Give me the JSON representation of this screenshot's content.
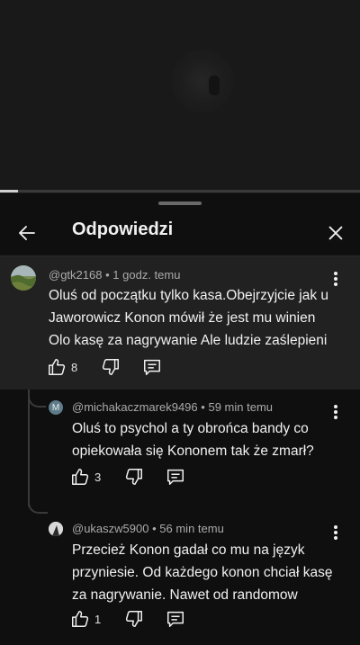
{
  "video": {
    "progress_fraction": 0.05
  },
  "header": {
    "title": "Odpowiedzi"
  },
  "comments": [
    {
      "author": "@gtk2168",
      "separator": "•",
      "time": "1 godz. temu",
      "lines": [
        "Oluś od początku tylko kasa.Obejrzyjcie jak u",
        "Jaworowicz Konon mówił że jest mu winien",
        "Olo kasę za nagrywanie Ale ludzie zaślepieni"
      ],
      "likes": "8"
    },
    {
      "author": "@michakaczmarek9496",
      "avatar_letter": "M",
      "separator": "•",
      "time": "59 min temu",
      "lines": [
        "Oluś to psychol a ty obrońca bandy co",
        "opiekowała się Kononem tak że zmarł?"
      ],
      "likes": "3"
    },
    {
      "author": "@ukaszw5900",
      "separator": "•",
      "time": "56 min temu",
      "lines": [
        "Przecież Konon gadał co mu na język",
        "przyniesie. Od każdego konon chciał kasę",
        "za nagrywanie. Nawet od randomow"
      ],
      "likes": "1"
    }
  ],
  "colors": {
    "background": "#0f0f0f",
    "highlight": "#212121",
    "text": "#f1f1f1",
    "meta": "#aaaaaa",
    "avatar_m": "#5f7c8a"
  },
  "icons": [
    "back-arrow-icon",
    "close-icon",
    "more-vert-icon",
    "thumb-up-icon",
    "thumb-down-icon",
    "reply-icon"
  ]
}
